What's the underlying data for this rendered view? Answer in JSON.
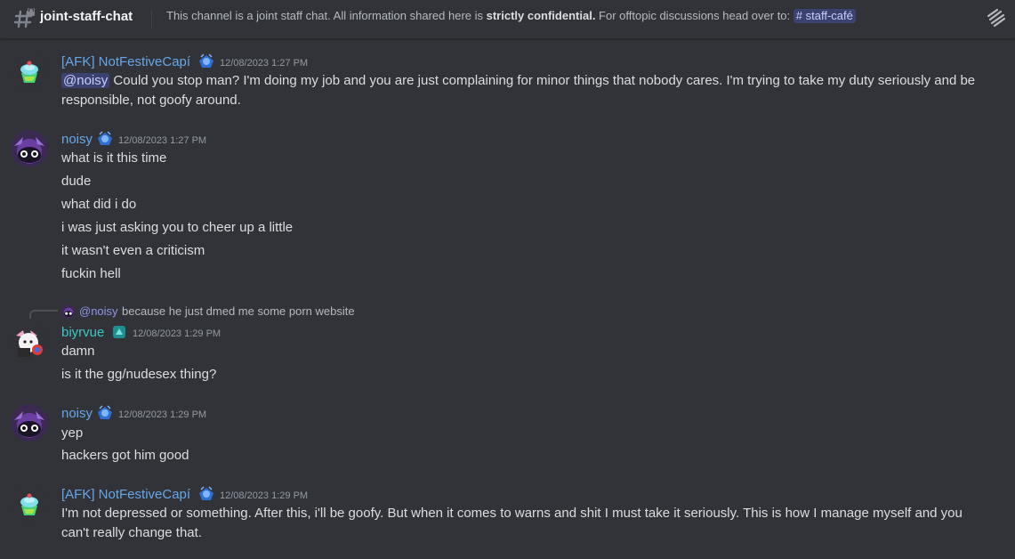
{
  "header": {
    "channel_name": "joint-staff-chat",
    "topic_part1": "This channel is a joint staff chat. All information shared here is ",
    "topic_bold": "strictly confidential.",
    "topic_part2": " For offtopic discussions head over to: ",
    "topic_channel": "staff-café"
  },
  "messages": [
    {
      "author": "[AFK] NotFestiveCapí",
      "timestamp": "12/08/2023 1:27 PM",
      "mention": "@noisy",
      "line1": "Could you stop man? I'm doing my job and you are just complaining for minor things that nobody cares. I'm trying to take my duty seriously and be",
      "line2": "responsible, not goofy around."
    },
    {
      "author": "noisy",
      "timestamp": "12/08/2023 1:27 PM",
      "lines": [
        "what is it this time",
        "dude",
        "what did i do",
        "i was just asking you to cheer up a little",
        "it wasn't even a criticism",
        "fuckin hell"
      ]
    },
    {
      "reply_to": "@noisy",
      "reply_text": "because he just dmed me some porn website",
      "author": "biyrvue",
      "timestamp": "12/08/2023 1:29 PM",
      "lines": [
        "damn",
        "is it the gg/nudesex thing?"
      ]
    },
    {
      "author": "noisy",
      "timestamp": "12/08/2023 1:29 PM",
      "lines": [
        "yep",
        "hackers got him good"
      ]
    },
    {
      "author": "[AFK] NotFestiveCapí",
      "timestamp": "12/08/2023 1:29 PM",
      "line1": "I'm not depressed or something. After this, i'll be goofy. But when it comes to warns and shit I must take it seriously. This is how I manage myself and you",
      "line2": "can't really change that."
    }
  ],
  "colors": {
    "background": "#313338",
    "username_blue": "#66a7e8",
    "username_teal": "#3fc7c7",
    "mention_bg": "#3c4270"
  }
}
